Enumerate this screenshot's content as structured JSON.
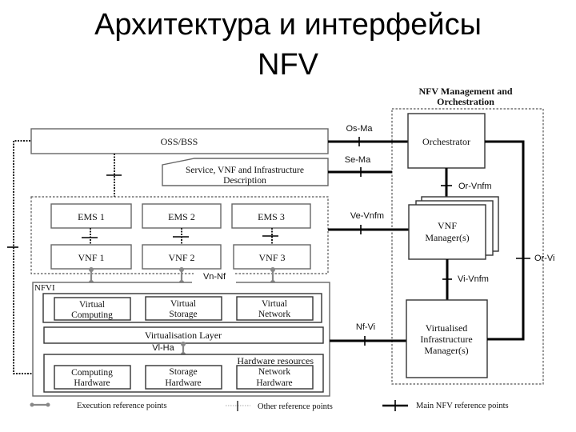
{
  "title": {
    "line1": "Архитектура и интерфейсы",
    "line2": "NFV"
  },
  "diagram": {
    "mano_title_line1": "NFV Management and",
    "mano_title_line2": "Orchestration",
    "oss_bss": "OSS/BSS",
    "service_desc_line1": "Service, VNF and Infrastructure",
    "service_desc_line2": "Description",
    "ems": [
      "EMS 1",
      "EMS 2",
      "EMS 3"
    ],
    "vnf": [
      "VNF 1",
      "VNF 2",
      "VNF 3"
    ],
    "nfvi_label": "NFVI",
    "virtual_resources": [
      {
        "line1": "Virtual",
        "line2": "Computing"
      },
      {
        "line1": "Virtual",
        "line2": "Storage"
      },
      {
        "line1": "Virtual",
        "line2": "Network"
      }
    ],
    "virtualisation_layer": "Virtualisation Layer",
    "hardware_resources_label": "Hardware resources",
    "hardware": [
      {
        "line1": "Computing",
        "line2": "Hardware"
      },
      {
        "line1": "Storage",
        "line2": "Hardware"
      },
      {
        "line1": "Network",
        "line2": "Hardware"
      }
    ],
    "orchestrator": "Orchestrator",
    "vnf_manager_line1": "VNF",
    "vnf_manager_line2": "Manager(s)",
    "vim_line1": "Virtualised",
    "vim_line2": "Infrastructure",
    "vim_line3": "Manager(s)",
    "reference_points": {
      "os_ma": "Os-Ma",
      "se_ma": "Se-Ma",
      "ve_vnfm": "Ve-Vnfm",
      "nf_vi": "Nf-Vi",
      "or_vnfm": "Or-Vnfm",
      "vi_vnfm": "Vi-Vnfm",
      "or_vi": "Or-Vi",
      "vn_nf": "Vn-Nf",
      "vi_ha": "Vl-Ha"
    }
  },
  "legend": {
    "execution": "Execution reference points",
    "other": "Other reference points",
    "main": "Main NFV reference points"
  }
}
